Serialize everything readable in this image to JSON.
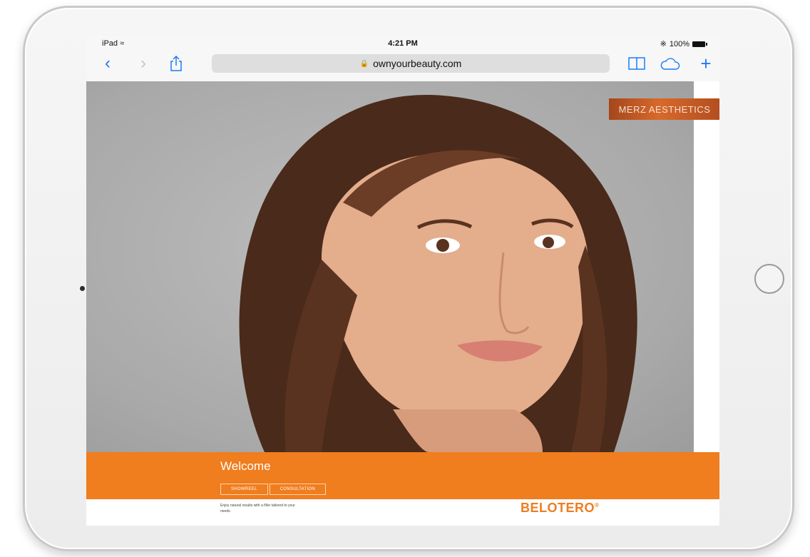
{
  "status_bar": {
    "device": "iPad",
    "time": "4:21 PM",
    "battery": "100%"
  },
  "browser": {
    "back_glyph": "‹",
    "forward_glyph": "›",
    "url": "ownyourbeauty.com",
    "icons": [
      "back-icon",
      "forward-icon",
      "share-icon",
      "book-icon",
      "cloud-icon",
      "plus-icon"
    ]
  },
  "page": {
    "badge": "MERZ AESTHETICS",
    "welcome": "Welcome",
    "buttons": [
      "SHOWREEL",
      "CONSULTATION"
    ],
    "tagline": "Enjoy natural results with a filler tailored to your needs.",
    "logo": "BELOTERO",
    "logo_mark": "®"
  },
  "colors": {
    "accent_orange": "#f07d1e",
    "ios_blue": "#1a7cf5",
    "badge_copper": "#b9521f"
  }
}
